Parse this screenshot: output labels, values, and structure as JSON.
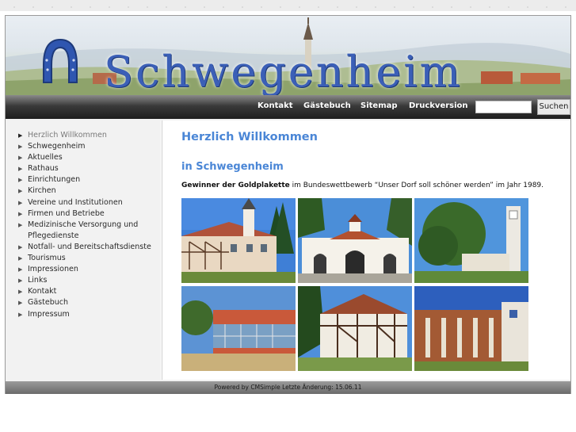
{
  "header": {
    "site_title": "Schwegenheim",
    "logo_icon": "horseshoe-icon"
  },
  "nav": {
    "items": [
      "Kontakt",
      "Gästebuch",
      "Sitemap",
      "Druckversion"
    ],
    "search_button": "Suchen",
    "search_value": ""
  },
  "sidebar": {
    "items": [
      {
        "label": "Herzlich Willkommen",
        "active": true
      },
      {
        "label": "Schwegenheim"
      },
      {
        "label": "Aktuelles"
      },
      {
        "label": "Rathaus"
      },
      {
        "label": "Einrichtungen"
      },
      {
        "label": "Kirchen"
      },
      {
        "label": "Vereine und Institutionen"
      },
      {
        "label": "Firmen und Betriebe"
      },
      {
        "label": "Medizinische Versorgung und Pflegedienste"
      },
      {
        "label": "Notfall- und Bereitschaftsdienste"
      },
      {
        "label": "Tourismus"
      },
      {
        "label": "Impressionen"
      },
      {
        "label": "Links"
      },
      {
        "label": "Kontakt"
      },
      {
        "label": "Gästebuch"
      },
      {
        "label": "Impressum"
      }
    ]
  },
  "main": {
    "heading": "Herzlich Willkommen",
    "subheading": "in Schwegenheim",
    "intro_bold": "Gewinner der Goldplakette",
    "intro_text": " im Bundeswettbewerb “Unser Dorf soll schöner werden” im Jahr 1989."
  },
  "footer": {
    "text": "Powered by CMSimple Letzte Änderung: 15.06.11"
  },
  "colors": {
    "heading": "#4a86d6",
    "title": "#3b5fb7",
    "navbar": "#2a2a2a"
  }
}
